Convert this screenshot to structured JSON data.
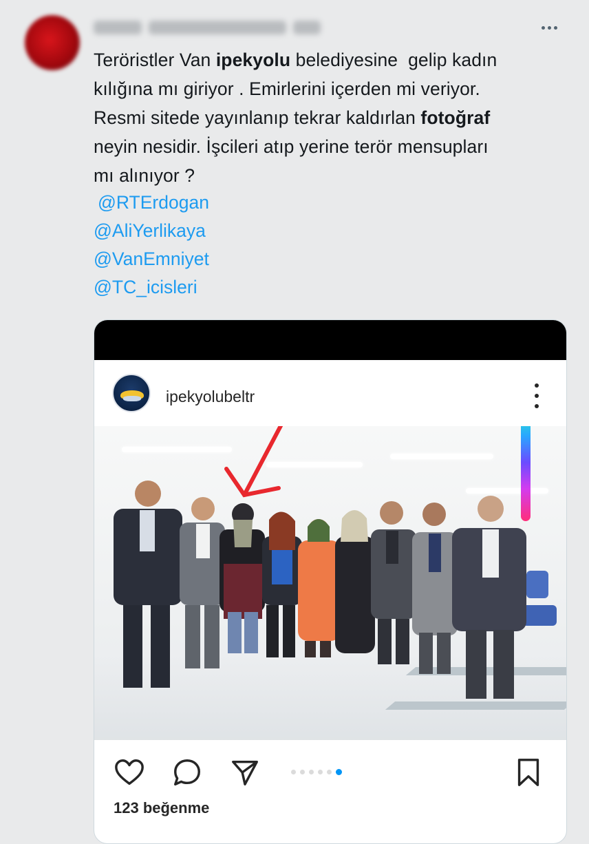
{
  "tweet": {
    "text_segments": [
      {
        "t": "Teröristler Van ",
        "b": false
      },
      {
        "t": "ipekyolu",
        "b": true
      },
      {
        "t": " belediyesine  gelip kadın\nkılığına mı giriyor . Emirlerini içerden mi veriyor.\nResmi sitede yayınlanıp tekrar kaldırlan ",
        "b": false
      },
      {
        "t": "fotoğraf",
        "b": true
      },
      {
        "t": "\nneyin nesidir. İşcileri atıp yerine terör mensupları\nmı alınıyor ?",
        "b": false
      }
    ],
    "mentions": [
      "@RTErdogan",
      "@AliYerlikaya",
      "@VanEmniyet",
      "@TC_icisleri"
    ],
    "icons": {
      "more": "more-horizontal-icon"
    }
  },
  "instagram": {
    "username": "ipekyolubeltr",
    "likes": "123 beğenme",
    "carousel": {
      "count": 6,
      "active_index": 5
    },
    "icons": [
      "heart-icon",
      "comment-icon",
      "send-icon",
      "bookmark-icon"
    ],
    "colors": {
      "accent": "#0095f6",
      "annotation_arrow": "#e8282e"
    }
  },
  "colors": {
    "mention": "#1d9bf0",
    "background": "#e9eaeb",
    "text": "#15191d"
  }
}
